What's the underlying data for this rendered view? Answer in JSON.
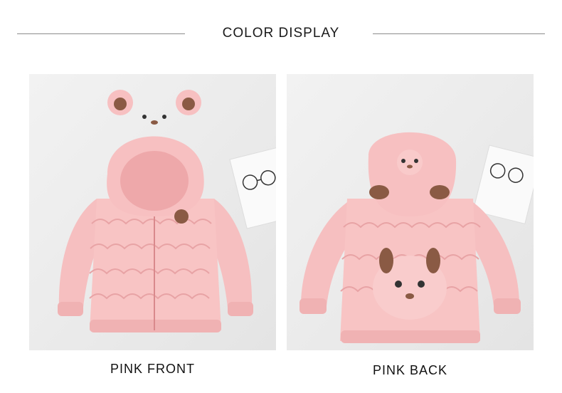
{
  "header": {
    "title": "COLOR DISPLAY"
  },
  "products": [
    {
      "caption": "PINK FRONT",
      "view": "front",
      "color": "#f7c2c2"
    },
    {
      "caption": "PINK BACK",
      "view": "back",
      "color": "#f7c2c2"
    }
  ],
  "colors": {
    "jacket_pink": "#f7c2c2",
    "jacket_shadow": "#e9a3a4",
    "ear_brown": "#8a5a44",
    "background": "#ededed"
  }
}
